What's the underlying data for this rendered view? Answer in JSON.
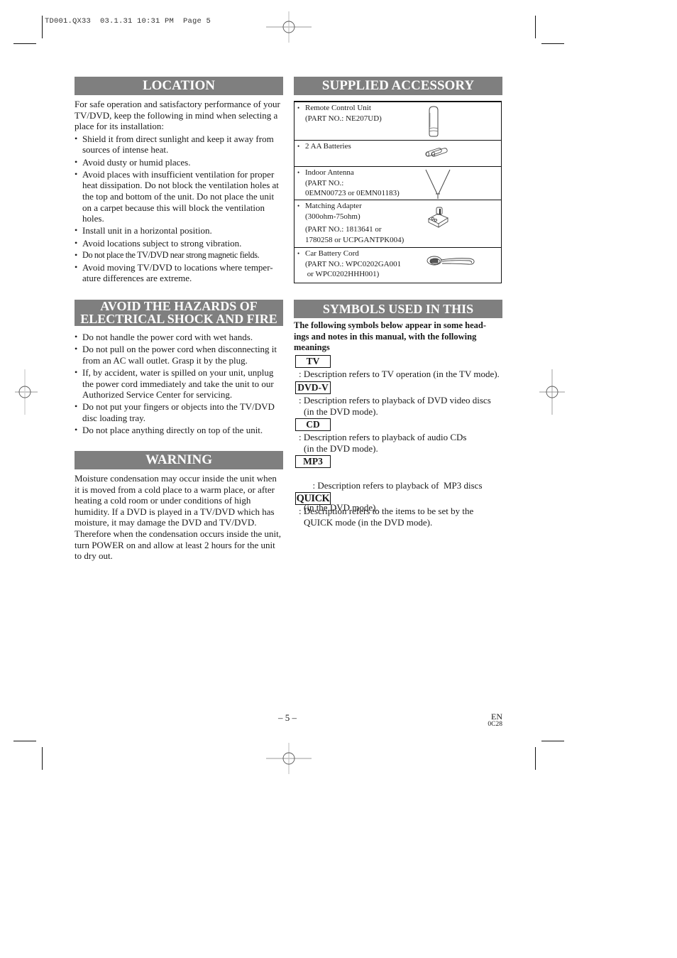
{
  "slug": "TD001.QX33  03.1.31 10:31 PM  Page 5",
  "location": {
    "title": "LOCATION",
    "intro": "For safe operation and satisfactory performance of your TV/DVD, keep the following in mind when selecting a place for its installation:",
    "bullets": [
      "Shield it from direct sunlight and keep it away from sources of intense heat.",
      "Avoid dusty or humid places.",
      "Avoid places with insufficient ventilation for proper heat dissipation. Do not block the ventilation holes at the top and bottom of the unit. Do not place the unit on a carpet because this will block the ventilation holes.",
      "Install unit in a horizontal position.",
      "Avoid locations subject to strong vibration.",
      "Do not place the TV/DVD near strong magnetic fields.",
      "Avoid moving TV/DVD to locations where temper-ature differences are extreme."
    ]
  },
  "hazards": {
    "title_line1": "AVOID THE HAZARDS OF",
    "title_line2": "ELECTRICAL SHOCK AND FIRE",
    "bullets": [
      "Do not handle the power cord with wet hands.",
      "Do not pull on the power cord when disconnecting it from an AC wall outlet. Grasp it by the plug.",
      "If, by accident, water is spilled on your unit, unplug the power cord immediately and take the unit to our Authorized Service Center for servicing.",
      "Do not put your fingers or objects into the TV/DVD disc loading tray.",
      "Do not place anything directly on top of the unit."
    ]
  },
  "warning": {
    "title": "WARNING",
    "text": "Moisture condensation may occur inside the unit when it is moved from a cold place to a warm place, or after heating a cold room or under conditions of high humidity. If a DVD is played in a TV/DVD which has moisture, it may damage the DVD and TV/DVD. Therefore when the condensation occurs inside the unit, turn POWER on and allow at least 2 hours for the unit to dry out."
  },
  "accessory": {
    "title": "SUPPLIED ACCESSORY",
    "items": [
      {
        "name": "Remote Control Unit",
        "lines": [
          "(PART NO.: NE207UD)"
        ],
        "icon": "remote-control-icon"
      },
      {
        "name": "2 AA Batteries",
        "lines": [],
        "icon": "batteries-icon"
      },
      {
        "name": "Indoor Antenna",
        "lines": [
          "(PART NO.:",
          "0EMN00723 or 0EMN01183)"
        ],
        "icon": "antenna-icon"
      },
      {
        "name": "Matching Adapter",
        "lines": [
          "(300ohm-75ohm)",
          "(PART NO.: 1813641 or",
          "1780258 or UCPGANTPK004)"
        ],
        "icon": "adapter-icon"
      },
      {
        "name": "Car Battery Cord",
        "lines": [
          "(PART NO.: WPC0202GA001",
          " or WPC0202HHH001)"
        ],
        "icon": "cord-icon"
      }
    ]
  },
  "symbols": {
    "title": "SYMBOLS USED IN THIS MANUAL",
    "intro": "The following symbols below appear in some head-ings and notes in this manual, with the following meanings",
    "items": [
      {
        "label": "TV",
        "desc": ": Description refers to TV operation (in the TV mode).",
        "desc2": ""
      },
      {
        "label": "DVD-V",
        "desc": ": Description refers to playback of DVD video discs",
        "desc2": "(in the DVD mode)."
      },
      {
        "label": "CD",
        "desc": ": Description refers to playback of audio CDs",
        "desc2": "(in the DVD mode)."
      },
      {
        "label": "MP3",
        "desc": ": Description refers to playback of  MP3 discs",
        "desc2": "(in the DVD mode)."
      },
      {
        "label": "QUICK",
        "desc": ": Description refers to the items to be set by the",
        "desc2": "QUICK mode (in the DVD mode)."
      }
    ]
  },
  "footer": {
    "page_number": "– 5 –",
    "lang": "EN",
    "code": "0C28"
  },
  "colors": {
    "header_bar": "#7f7f7f",
    "header_text": "#ffffff",
    "text": "#1a1a1a"
  }
}
